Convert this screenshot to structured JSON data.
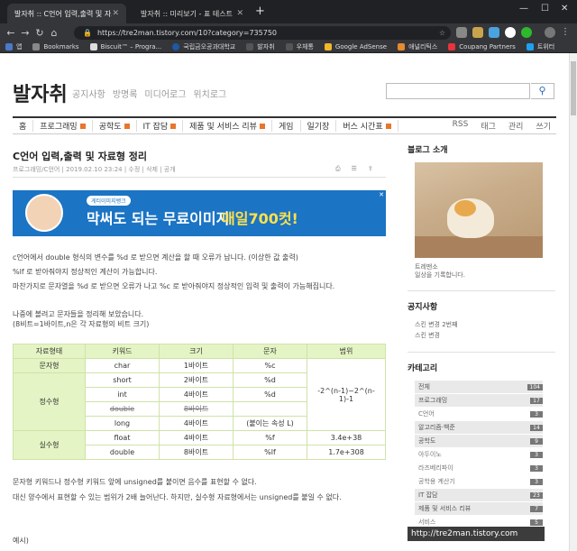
{
  "browser": {
    "tabs": [
      {
        "title": "발자취 :: C언어 입력,출력 및 자료형 정리",
        "active": true
      },
      {
        "title": "발자취 :: 미리보기 - 표 테스트",
        "active": false
      }
    ],
    "url": "https://tre2man.tistory.com/10?category=735750",
    "bookmarks": [
      "앱",
      "Bookmarks",
      "Biscuit™ – Progra...",
      "국립금오공과대학교",
      "발자취",
      "우체통",
      "Google AdSense",
      "애널리틱스",
      "Coupang Partners",
      "트위터"
    ],
    "colors": {
      "tabbar": "#202124",
      "toolbar": "#35363a"
    }
  },
  "blog": {
    "logo": "발자취",
    "top_nav": [
      "공지사항",
      "방명록",
      "미디어로그",
      "위치로그"
    ],
    "categories": [
      "홈",
      "프로그래밍",
      "공학도",
      "IT 잡담",
      "제품 및 서비스 리뷰",
      "게임",
      "일기장",
      "버스 시간표"
    ],
    "right_nav": [
      "RSS",
      "태그",
      "관리",
      "쓰기"
    ]
  },
  "post": {
    "title": "C언어 입력,출력 및 자료형 정리",
    "meta": "프로그래밍/C언어 | 2019.02.10 23:24 | 수정 | 삭제 | 공개",
    "ad": {
      "small": "게티이미지뱅크",
      "headline": "막써도 되는 무료이미지",
      "highlight": "매일700컷!"
    },
    "paragraphs": [
      "c언어에서 double 형식의 변수를 %d 로 받으면 계산을 할 때 오류가 납니다. (이상한 값 출력)",
      "%lf 로 받아줘야지 정상적인 계산이 가능합니다.",
      "마찬가지로 문자열을 %d 로 받으면 오류가 나고 %c 로 받아줘야지 정상적인 입력 및 출력이 가능해집니다.",
      "나중에 볼려고 문자들을 정리해 보았습니다.",
      "(8비트=1바이트,n은 각 자료형의 비트 크기)"
    ],
    "table": {
      "headers": [
        "자료형태",
        "키워드",
        "크기",
        "문자",
        "범위"
      ],
      "rows": {
        "r1": [
          "문자형",
          "char",
          "1바이트",
          "%c"
        ],
        "r2": [
          "short",
          "2바이트",
          "%d"
        ],
        "r3": [
          "정수형",
          "int",
          "4바이트",
          "%d"
        ],
        "r4": [
          "double",
          "8바이트",
          ""
        ],
        "r5": [
          "long",
          "4바이트",
          "(붙이는 속성 L)"
        ],
        "r6": [
          "실수형",
          "float",
          "4바이트",
          "%f",
          "3.4e+38"
        ],
        "r7": [
          "double",
          "8바이트",
          "%lf",
          "1.7e+308"
        ],
        "range_int": "-2^(n-1)~2^(n-1)-1"
      }
    },
    "after": [
      "문자형 키워드나 정수형 키워드 앞에 unsigned를 붙이면 음수를 표현할 수 없다.",
      "대신 양수에서 표현할 수 있는 범위가 2배 늘어난다. 하지만, 실수형 자료형에서는 unsigned를 붙일 수 없다.",
      "예시)"
    ]
  },
  "sidebar": {
    "intro_title": "블로그 소개",
    "intro_lines": [
      "트레맨소",
      "일상을 기록합니다."
    ],
    "notice_title": "공지사항",
    "notices": [
      "스킨 변경 2번째",
      "스킨 변경"
    ],
    "category_title": "카테고리",
    "categories": [
      {
        "label": "전체",
        "count": "104",
        "shade": true
      },
      {
        "label": "프로그래밍",
        "count": "17",
        "shade": true
      },
      {
        "label": "C언어",
        "count": "3",
        "shade": false
      },
      {
        "label": "알고리즘·백준",
        "count": "14",
        "shade": true
      },
      {
        "label": "공학도",
        "count": "9",
        "shade": true
      },
      {
        "label": "아두이노",
        "count": "3",
        "shade": false
      },
      {
        "label": "라즈베리파이",
        "count": "3",
        "shade": false
      },
      {
        "label": "공학용 계산기",
        "count": "3",
        "shade": false
      },
      {
        "label": "IT 잡담",
        "count": "23",
        "shade": true
      },
      {
        "label": "제품 및 서비스 리뷰",
        "count": "7",
        "shade": true
      },
      {
        "label": "서비스",
        "count": "5",
        "shade": false
      }
    ]
  },
  "status_tooltip": "http://tre2man.tistory.com"
}
